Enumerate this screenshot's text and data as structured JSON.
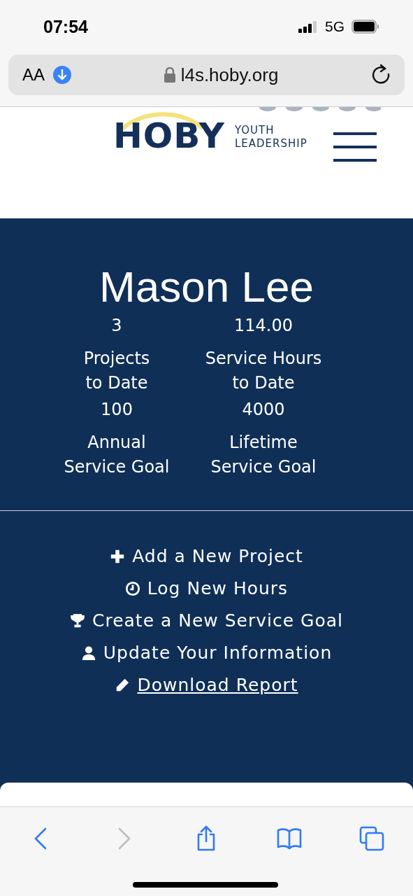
{
  "status_bar": {
    "time": "07:54",
    "network": "5G"
  },
  "address_bar": {
    "text_size": "AA",
    "url": "l4s.hoby.org"
  },
  "header": {
    "logo_word": "HOBY",
    "logo_tagline": [
      "YOUTH",
      "LEADERSHIP"
    ]
  },
  "profile": {
    "name": "Mason Lee",
    "stats": [
      {
        "value": "3",
        "label": "Projects\nto Date"
      },
      {
        "value": "114.00",
        "label": "Service Hours\nto Date"
      },
      {
        "value": "100",
        "label": "Annual\nService Goal"
      },
      {
        "value": "4000",
        "label": "Lifetime\nService Goal"
      }
    ]
  },
  "actions": [
    {
      "kind": "plus",
      "label": "Add a New Project",
      "underlined": false
    },
    {
      "kind": "clock",
      "label": "Log New Hours",
      "underlined": false
    },
    {
      "kind": "trophy",
      "label": "Create a New Service Goal",
      "underlined": false
    },
    {
      "kind": "user",
      "label": "Update Your Information",
      "underlined": false
    },
    {
      "kind": "pencil",
      "label": "Download Report",
      "underlined": true
    }
  ],
  "toolbar": [
    {
      "kind": "back",
      "disabled": false
    },
    {
      "kind": "forward",
      "disabled": true
    },
    {
      "kind": "share",
      "disabled": false
    },
    {
      "kind": "bookmarks",
      "disabled": false
    },
    {
      "kind": "tabs",
      "disabled": false
    }
  ]
}
